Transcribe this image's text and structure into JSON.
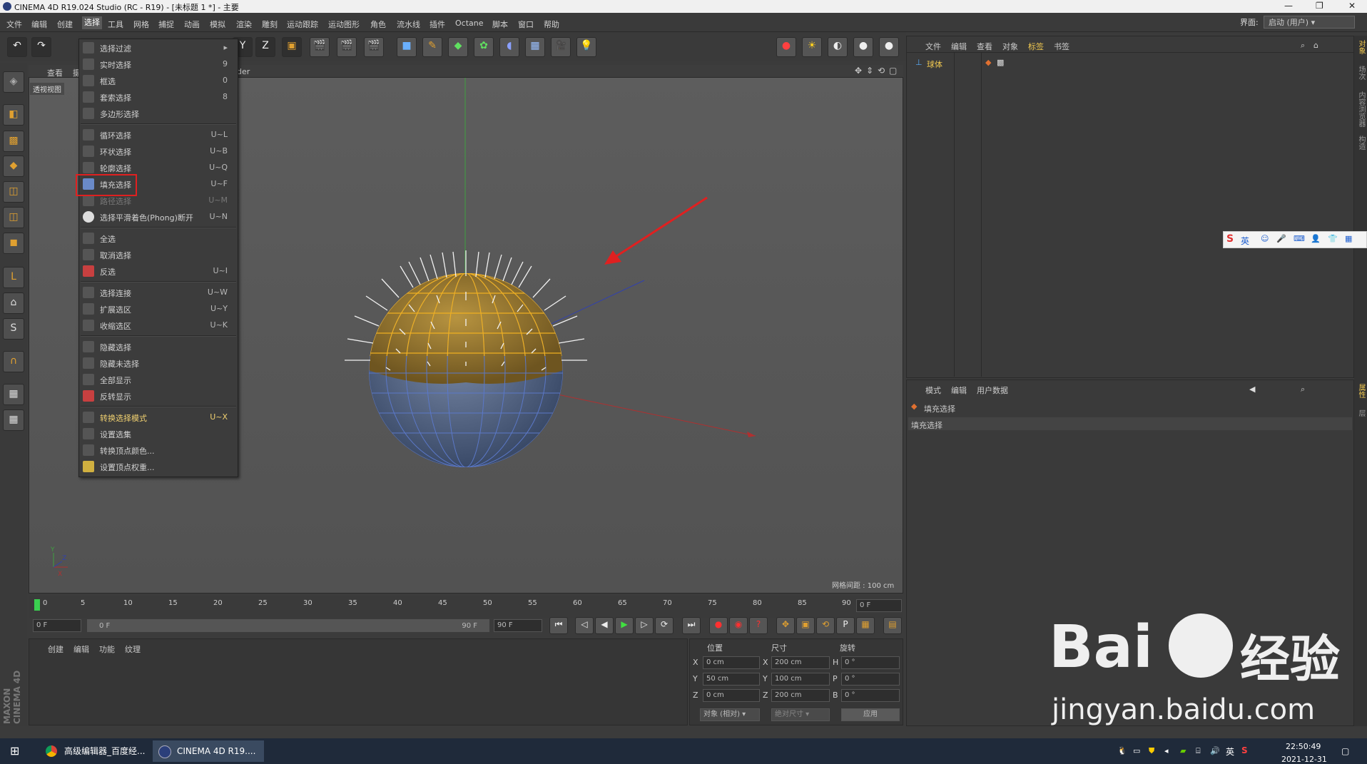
{
  "window": {
    "title": "CINEMA 4D R19.024 Studio (RC - R19) - [未标题 1 *] - 主要"
  },
  "menubar": {
    "items": [
      "文件",
      "编辑",
      "创建",
      "选择",
      "工具",
      "网格",
      "捕捉",
      "动画",
      "模拟",
      "渲染",
      "雕刻",
      "运动跟踪",
      "运动图形",
      "角色",
      "流水线",
      "插件",
      "Octane",
      "脚本",
      "窗口",
      "帮助"
    ],
    "active": "选择",
    "interface_label": "界面:",
    "interface_value": "启动 (用户)"
  },
  "viewport": {
    "header_items": [
      "查看",
      "摄"
    ],
    "header_partial": "der",
    "view_label": "透视视图",
    "grid_spacing": "网格间距 : 100 cm"
  },
  "select_menu": {
    "items": [
      {
        "label": "选择过滤",
        "shortcut": "",
        "submenu": true
      },
      {
        "label": "实时选择",
        "shortcut": "9"
      },
      {
        "label": "框选",
        "shortcut": "0"
      },
      {
        "label": "套索选择",
        "shortcut": "8"
      },
      {
        "label": "多边形选择",
        "shortcut": ""
      },
      {
        "sep": true
      },
      {
        "label": "循环选择",
        "shortcut": "U~L"
      },
      {
        "label": "环状选择",
        "shortcut": "U~B"
      },
      {
        "label": "轮廓选择",
        "shortcut": "U~Q"
      },
      {
        "label": "填充选择",
        "shortcut": "U~F",
        "highlighted": true
      },
      {
        "label": "路径选择",
        "shortcut": "U~M",
        "disabled": true
      },
      {
        "label": "选择平滑着色(Phong)断开",
        "shortcut": "U~N"
      },
      {
        "sep": true
      },
      {
        "label": "全选",
        "shortcut": ""
      },
      {
        "label": "取消选择",
        "shortcut": ""
      },
      {
        "label": "反选",
        "shortcut": "U~I"
      },
      {
        "sep": true
      },
      {
        "label": "选择连接",
        "shortcut": "U~W"
      },
      {
        "label": "扩展选区",
        "shortcut": "U~Y"
      },
      {
        "label": "收缩选区",
        "shortcut": "U~K"
      },
      {
        "sep": true
      },
      {
        "label": "隐藏选择",
        "shortcut": ""
      },
      {
        "label": "隐藏未选择",
        "shortcut": ""
      },
      {
        "label": "全部显示",
        "shortcut": ""
      },
      {
        "label": "反转显示",
        "shortcut": ""
      },
      {
        "sep": true
      },
      {
        "label": "转换选择模式",
        "shortcut": "U~X",
        "bold": true
      },
      {
        "label": "设置选集",
        "shortcut": ""
      },
      {
        "label": "转换顶点颜色...",
        "shortcut": ""
      },
      {
        "label": "设置顶点权重...",
        "shortcut": ""
      }
    ]
  },
  "object_manager": {
    "tabs": [
      "文件",
      "编辑",
      "查看",
      "对象",
      "标签",
      "书签"
    ],
    "active_tab": "标签",
    "object_name": "球体"
  },
  "attribute_manager": {
    "tabs": [
      "模式",
      "编辑",
      "用户数据"
    ],
    "title": "填充选择",
    "row": "填充选择"
  },
  "right_tabs": [
    "对象",
    "场次",
    "内容浏览器",
    "构造",
    "属性",
    "层"
  ],
  "timeline": {
    "ticks": [
      "0",
      "5",
      "10",
      "15",
      "20",
      "25",
      "30",
      "35",
      "40",
      "45",
      "50",
      "55",
      "60",
      "65",
      "70",
      "75",
      "80",
      "85",
      "90"
    ],
    "current_frame": "0 F",
    "start": "0 F",
    "range_start": "0 F",
    "range_end": "90 F",
    "end": "90 F"
  },
  "material_manager": {
    "tabs": [
      "创建",
      "编辑",
      "功能",
      "纹理"
    ]
  },
  "coordinates": {
    "headers": [
      "位置",
      "尺寸",
      "旋转"
    ],
    "rows": [
      {
        "axis": "X",
        "pos": "0 cm",
        "size_axis": "X",
        "size": "200 cm",
        "rot_axis": "H",
        "rot": "0 °"
      },
      {
        "axis": "Y",
        "pos": "50 cm",
        "size_axis": "Y",
        "size": "100 cm",
        "rot_axis": "P",
        "rot": "0 °"
      },
      {
        "axis": "Z",
        "pos": "0 cm",
        "size_axis": "Z",
        "size": "200 cm",
        "rot_axis": "B",
        "rot": "0 °"
      }
    ],
    "mode1": "对象 (相对)",
    "mode2": "绝对尺寸",
    "apply": "应用"
  },
  "maxon_logo": "MAXON CINEMA 4D",
  "ime": {
    "lang": "英"
  },
  "taskbar": {
    "tasks": [
      "高级编辑器_百度经...",
      "CINEMA 4D R19...."
    ],
    "ime_lang": "英",
    "time": "22:50:49",
    "date": "2021-12-31"
  },
  "watermark": {
    "brand": "Bai",
    "brand2": "经验",
    "url": "jingyan.baidu.com"
  }
}
